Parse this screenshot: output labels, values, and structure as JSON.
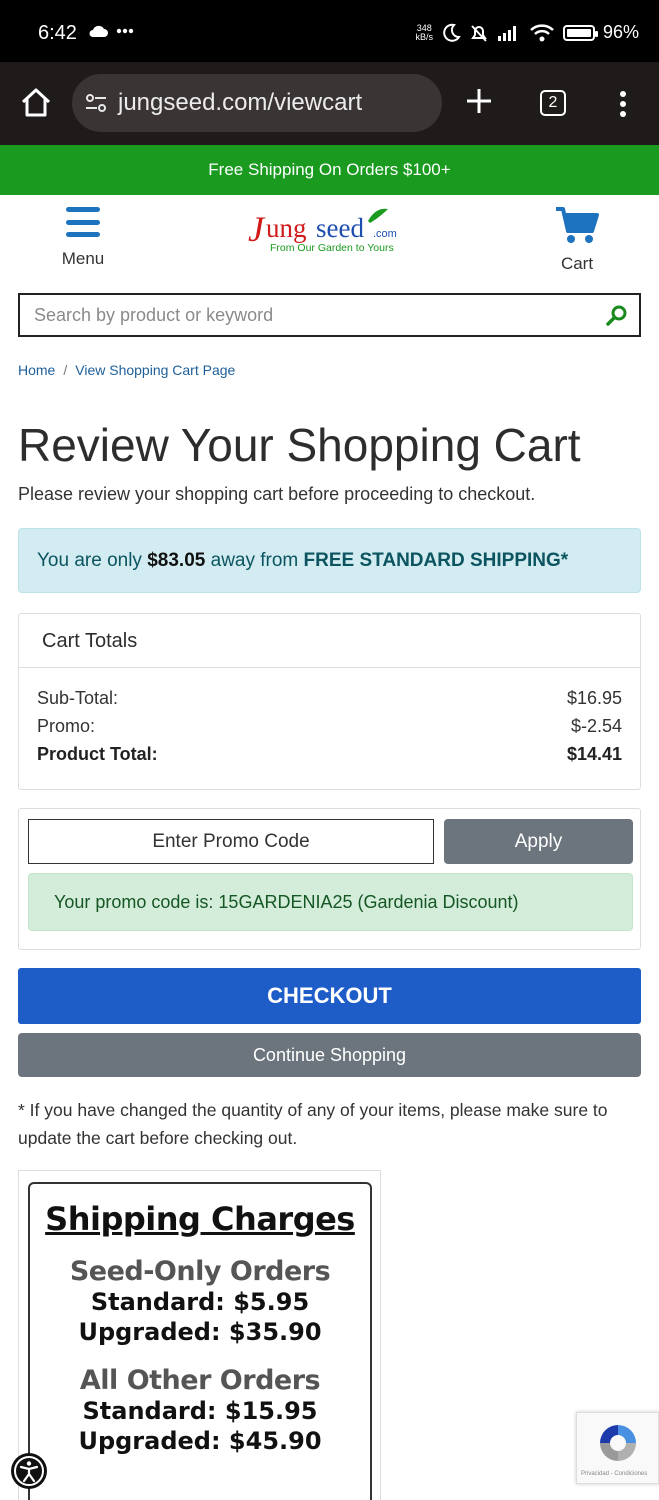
{
  "status_bar": {
    "time": "6:42",
    "net_speed_top": "348",
    "net_speed_unit": "kB/s",
    "battery": "96%"
  },
  "browser": {
    "url": "jungseed.com/viewcart",
    "tab_count": "2"
  },
  "promo_banner": {
    "text": "Free Shipping On Orders $100+"
  },
  "header": {
    "menu_label": "Menu",
    "cart_label": "Cart",
    "logo_name": "Jungseed",
    "logo_suffix": ".com",
    "logo_tagline": "From Our Garden to Yours"
  },
  "search": {
    "placeholder": "Search by product or keyword"
  },
  "breadcrumb": {
    "home": "Home",
    "separator": "/",
    "current": "View Shopping Cart Page"
  },
  "page": {
    "title": "Review Your Shopping Cart",
    "subtitle": "Please review your shopping cart before proceeding to checkout."
  },
  "shipping_notice": {
    "prefix": "You are only ",
    "amount": "$83.05",
    "middle": " away from ",
    "highlight": "FREE STANDARD SHIPPING*"
  },
  "cart_totals": {
    "title": "Cart Totals",
    "rows": [
      {
        "label": "Sub-Total:",
        "value": "$16.95"
      },
      {
        "label": "Promo:",
        "value": "$-2.54"
      },
      {
        "label": "Product Total:",
        "value": "$14.41"
      }
    ]
  },
  "promo": {
    "placeholder": "Enter Promo Code",
    "apply_label": "Apply",
    "success_message": "Your promo code is: 15GARDENIA25 (Gardenia Discount)"
  },
  "actions": {
    "checkout_label": "CHECKOUT",
    "continue_label": "Continue Shopping"
  },
  "footnote": "* If you have changed the quantity of any of your items, please make sure to update the cart before checking out.",
  "shipping_charges": {
    "title": "Shipping Charges",
    "seed_heading": "Seed-Only Orders",
    "seed_standard": "Standard: $5.95",
    "seed_upgraded": "Upgraded: $35.90",
    "other_heading": "All Other Orders",
    "other_standard": "Standard: $15.95",
    "other_upgraded": "Upgraded: $45.90"
  },
  "recaptcha": {
    "text": "Privacidad - Condiciones"
  },
  "colors": {
    "banner_green": "#1a9a1f",
    "brand_blue": "#1e73be",
    "checkout_blue": "#1e5cc8",
    "logo_red": "#d11a1a"
  }
}
